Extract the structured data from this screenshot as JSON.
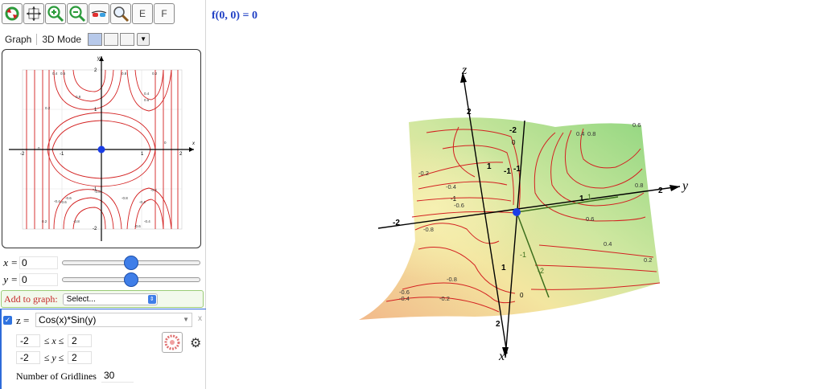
{
  "toolbar": {
    "buttons": [
      {
        "name": "reset-view-button",
        "icon": "refresh-icon"
      },
      {
        "name": "move-graph-button",
        "icon": "move-icon"
      },
      {
        "name": "zoom-in-button",
        "icon": "zoom-in-icon"
      },
      {
        "name": "zoom-out-button",
        "icon": "zoom-out-icon"
      },
      {
        "name": "anaglyph-button",
        "icon": "glasses-icon"
      },
      {
        "name": "zoom-box-button",
        "icon": "magnifier-icon"
      }
    ],
    "e_label": "E",
    "f_label": "F"
  },
  "tabs": {
    "graph": "Graph",
    "mode3d": "3D Mode"
  },
  "graph2d": {
    "x_axis_label": "x",
    "y_axis_label": "y",
    "x_ticks": [
      "-2",
      "-1",
      "1",
      "2"
    ],
    "y_ticks": [
      "2",
      "1",
      "-1",
      "-2"
    ],
    "contour_labels": [
      "0.4",
      "0.6",
      "0.8",
      "0.2",
      "0.8",
      "0.4",
      "0.6",
      "0.2",
      "0",
      "-0.8",
      "-0.6",
      "-0.4",
      "-0.2",
      "-0.8",
      "-0.6",
      "-0.4",
      "0.2",
      "-0.8",
      "-0.4",
      "-0.6",
      "0"
    ]
  },
  "sliders": [
    {
      "label": "x =",
      "value": "0",
      "position": 0.5
    },
    {
      "label": "y =",
      "value": "0",
      "position": 0.5
    }
  ],
  "add_to_graph": {
    "label": "Add to graph:",
    "placeholder": "Select..."
  },
  "expression": {
    "checked": true,
    "var_label": "z =",
    "value": "Cos(x)*Sin(y)",
    "close": "x",
    "x_range": {
      "min": "-2",
      "mid": "≤ x ≤",
      "max": "2"
    },
    "y_range": {
      "min": "-2",
      "mid": "≤ y ≤",
      "max": "2"
    },
    "gridlines_label": "Number of Gridlines",
    "gridlines_value": "30"
  },
  "function_value": "f(0, 0) = 0",
  "view3d": {
    "z_label": "z",
    "y_label": "y",
    "x_label": "x",
    "z_ticks": [
      "2",
      "1"
    ],
    "y_ticks": [
      "-2",
      "-1",
      "1",
      "2"
    ],
    "x_ticks": [
      "-2",
      "-1",
      "1",
      "2"
    ],
    "inner_ticks": [
      "-2",
      "0",
      "-1",
      "-1",
      "1",
      "-2",
      "0"
    ],
    "contour_labels": [
      "-0.2",
      "-0.4",
      "-0.6",
      "-0.8",
      "-0.8",
      "-0.6",
      "-0.4",
      "-0.2",
      "0.2",
      "0.4",
      "0.6",
      "0.8",
      "0.4",
      "0.2",
      "0.8",
      "0.6"
    ]
  },
  "colors": {
    "accent": "#3f7ee8",
    "contour": "#d32020",
    "fn_text": "#2141c5",
    "add_label": "#c62828"
  }
}
